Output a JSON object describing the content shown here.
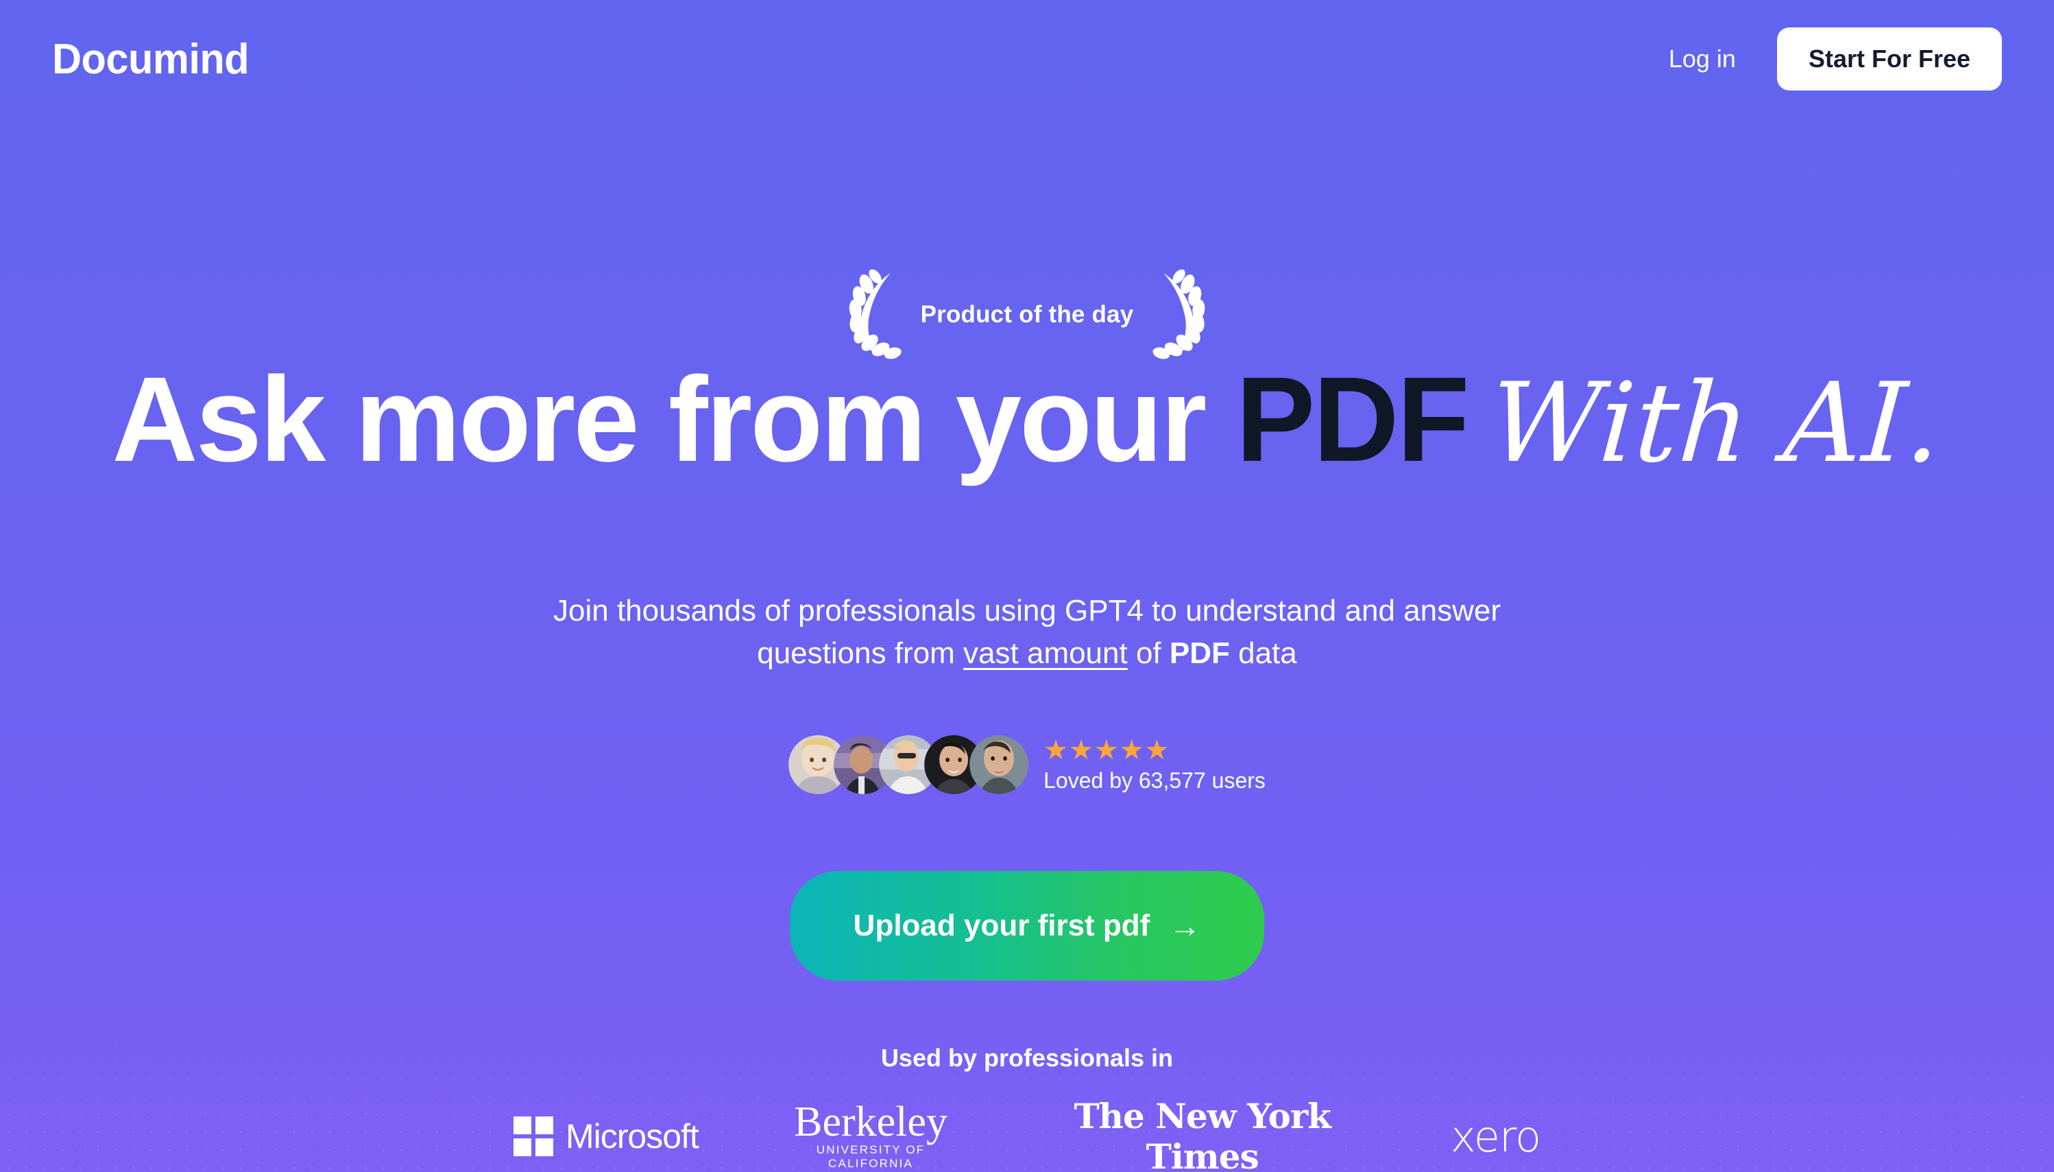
{
  "brand": {
    "name": "Documind",
    "accent_purple_top": "#6065EF",
    "accent_purple_bottom": "#7D61F5"
  },
  "nav": {
    "login_label": "Log in",
    "cta_label": "Start For Free"
  },
  "hero": {
    "badge_text": "Product of the day",
    "headline_part1": "Ask more from your ",
    "headline_pdf": "PDF",
    "headline_script": "With AI.",
    "subhead_line1": "Join thousands of professionals using GPT4 to understand and answer",
    "subhead_pre": "questions from ",
    "subhead_underlined": "vast amount",
    "subhead_mid": " of ",
    "subhead_bold": "PDF",
    "subhead_post": " data",
    "pdf_color": "#101827"
  },
  "social_proof": {
    "stars": "★★★★★",
    "star_color": "#F9A838",
    "loved_text": "Loved by 63,577 users",
    "avatar_count": 5,
    "avatars": [
      {
        "name": "avatar-1"
      },
      {
        "name": "avatar-2"
      },
      {
        "name": "avatar-3"
      },
      {
        "name": "avatar-4"
      },
      {
        "name": "avatar-5"
      }
    ]
  },
  "cta": {
    "label": "Upload your first pdf",
    "arrow": "→",
    "gradient_from": "#0CB5B8",
    "gradient_to": "#2ECB4D"
  },
  "logos_section": {
    "heading": "Used by professionals in",
    "items": [
      {
        "name": "microsoft",
        "label": "Microsoft"
      },
      {
        "name": "berkeley",
        "label": "Berkeley",
        "sublabel": "UNIVERSITY OF CALIFORNIA"
      },
      {
        "name": "new-york-times",
        "label": "The New York Times"
      },
      {
        "name": "xero",
        "label": "xero"
      }
    ]
  }
}
